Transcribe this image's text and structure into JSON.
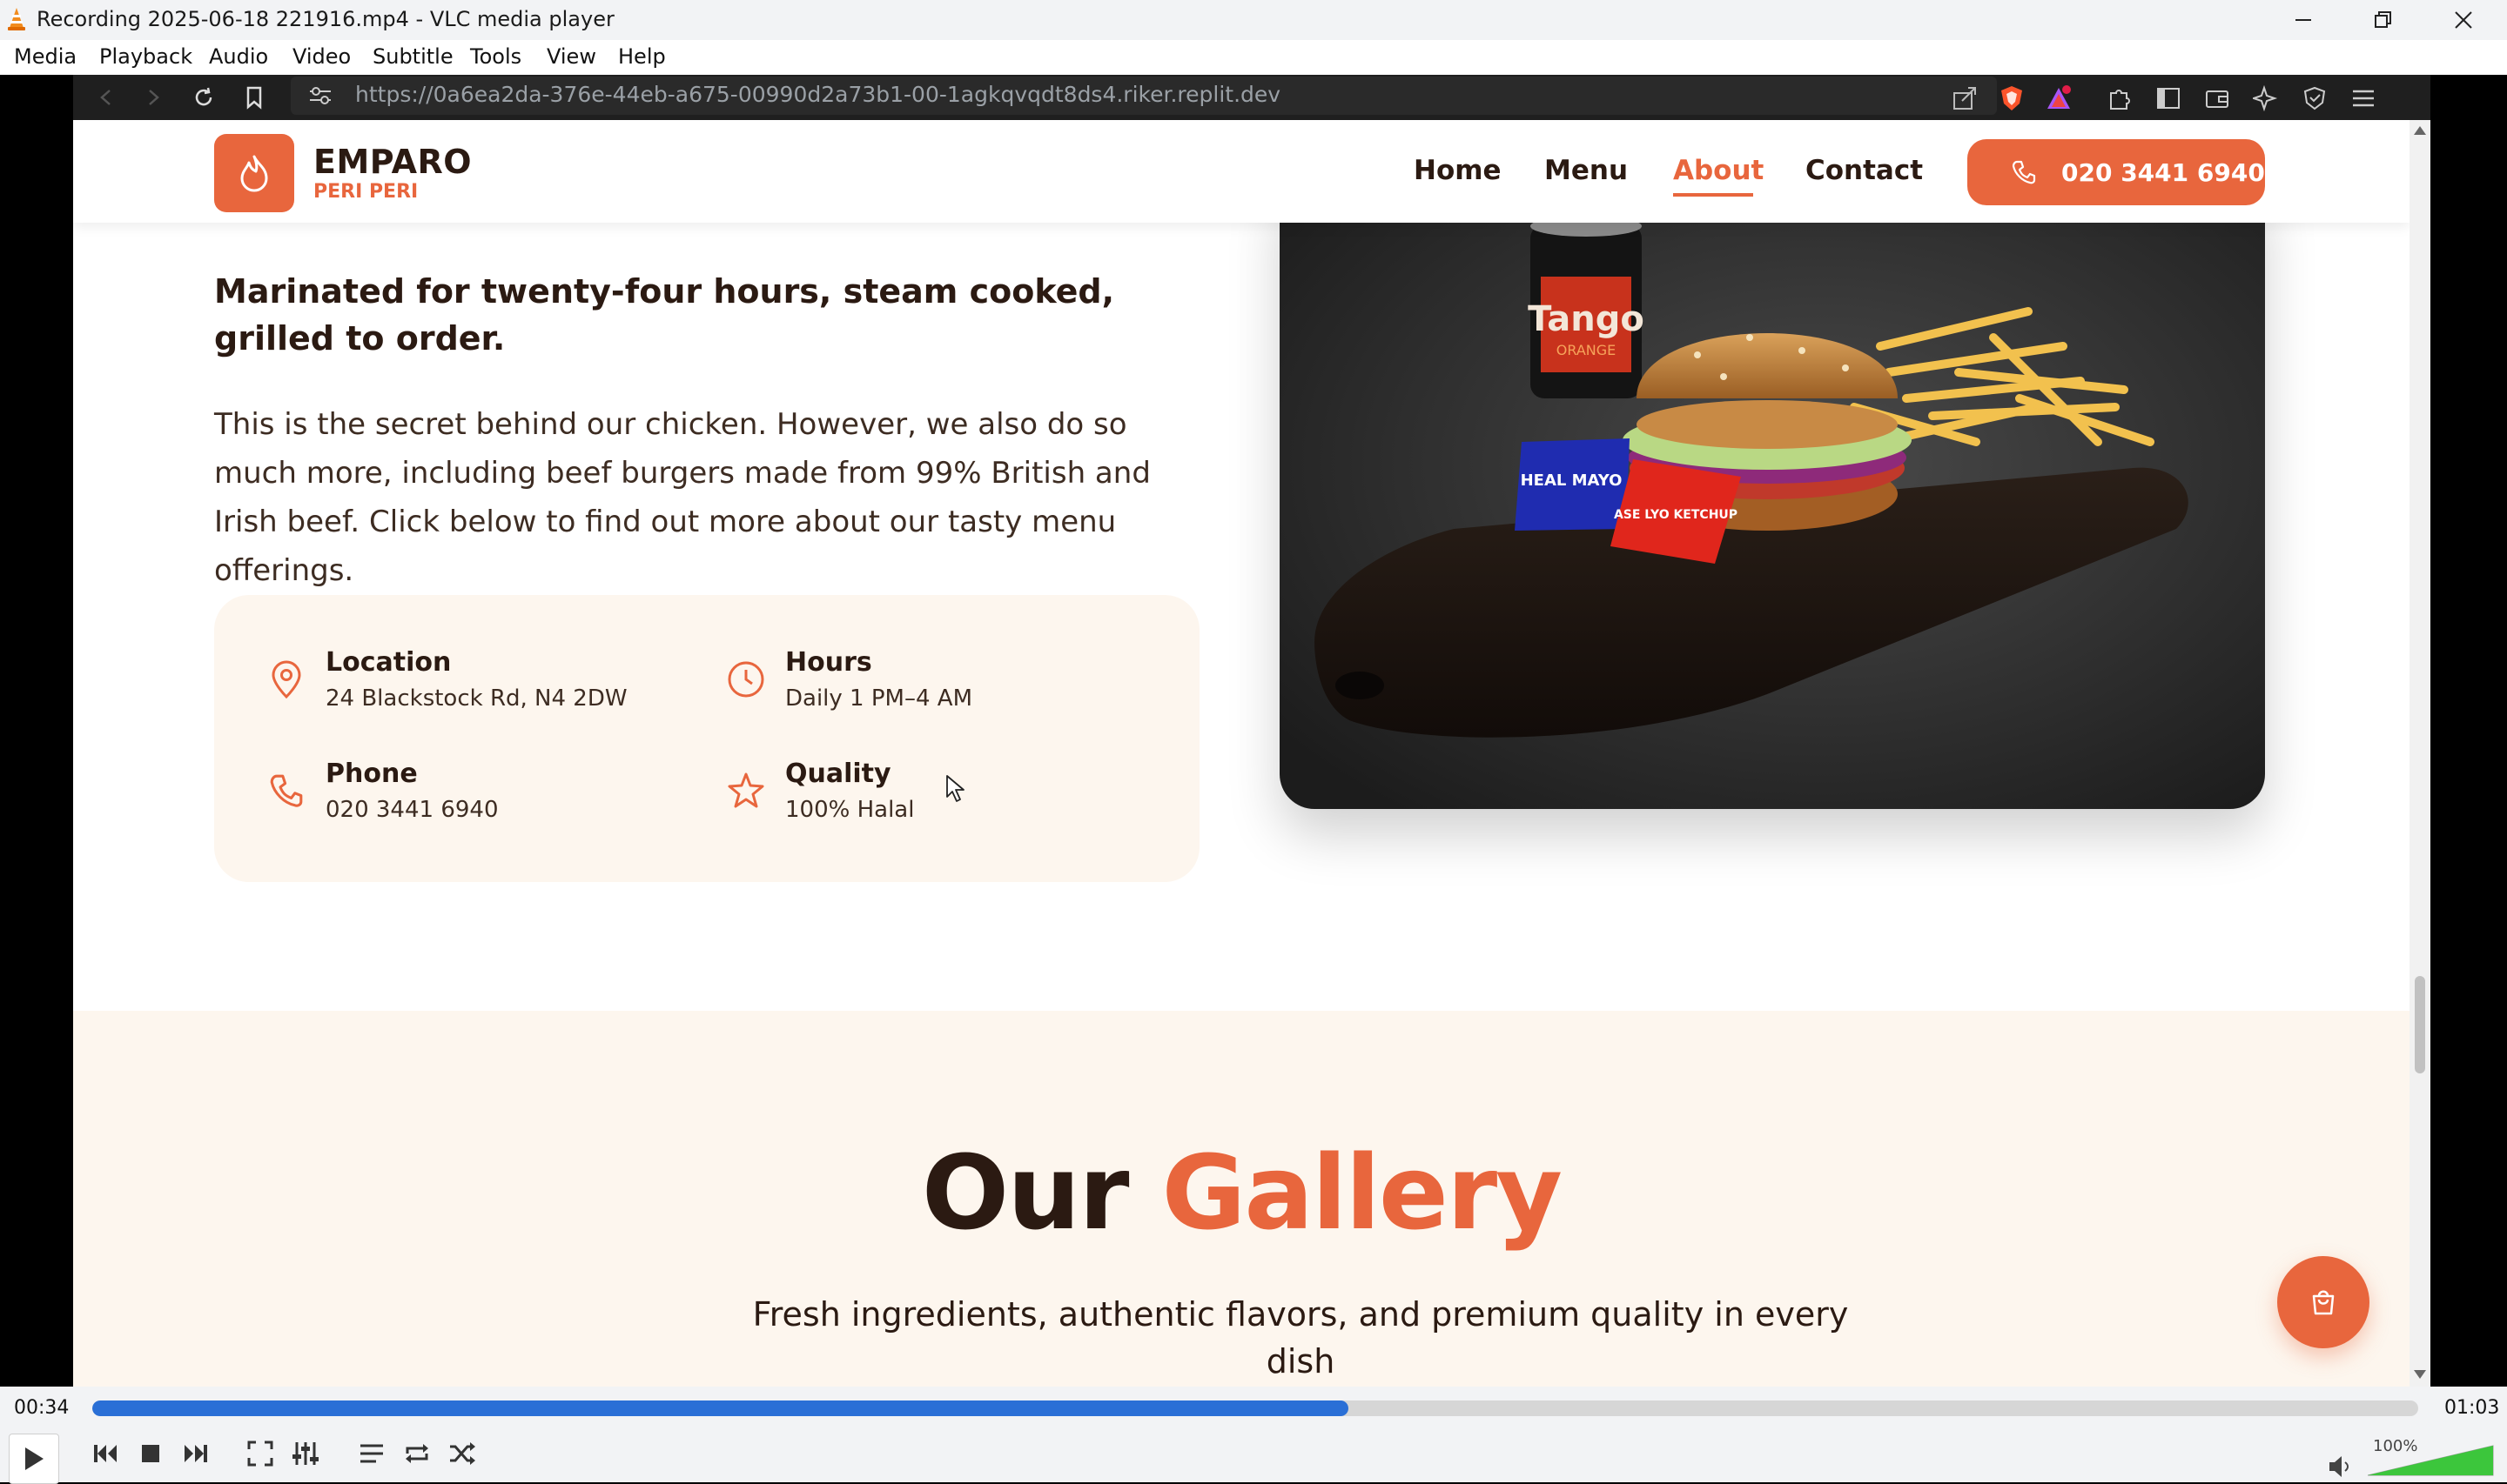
{
  "window": {
    "title": "Recording 2025-06-18 221916.mp4 - VLC media player"
  },
  "menubar": {
    "items": [
      "Media",
      "Playback",
      "Audio",
      "Video",
      "Subtitle",
      "Tools",
      "View",
      "Help"
    ]
  },
  "browser": {
    "url": "https://0a6ea2da-376e-44eb-a675-00990d2a73b1-00-1agkqvqdt8ds4.riker.replit.dev"
  },
  "site": {
    "brand": {
      "name": "EMPARO",
      "tagline": "PERI PERI"
    },
    "nav": {
      "items": [
        "Home",
        "Menu",
        "About",
        "Contact"
      ],
      "active": "About",
      "phone_button": "020 3441 6940"
    },
    "about": {
      "lead": "Marinated for twenty-four hours, steam cooked, grilled to order.",
      "body": "This is the secret behind our chicken. However, we also do so much more, including beef burgers made from 99% British and Irish beef. Click below to find out more about our tasty menu offerings."
    },
    "info": {
      "location": {
        "title": "Location",
        "value": "24 Blackstock Rd, N4 2DW"
      },
      "hours": {
        "title": "Hours",
        "value": "Daily 1 PM–4 AM"
      },
      "phone": {
        "title": "Phone",
        "value": "020 3441 6940"
      },
      "quality": {
        "title": "Quality",
        "value": "100% Halal"
      }
    },
    "gallery": {
      "title_part1": "Our",
      "title_part2": "Gallery",
      "subtitle": "Fresh ingredients, authentic flavors, and premium quality in every dish"
    },
    "image_labels": {
      "can": "Tango",
      "can_sub": "ORANGE",
      "sachet1": "HEAL MAYO",
      "sachet2": "ASE LYO KETCHUP"
    }
  },
  "player": {
    "time_current": "00:34",
    "time_total": "01:03",
    "progress": 0.54,
    "volume_label": "100%",
    "volume": 1.0
  },
  "colors": {
    "accent": "#e8663d",
    "dark": "#2b1a12",
    "cream": "#fdf6ee",
    "seek": "#2a6fd6"
  }
}
